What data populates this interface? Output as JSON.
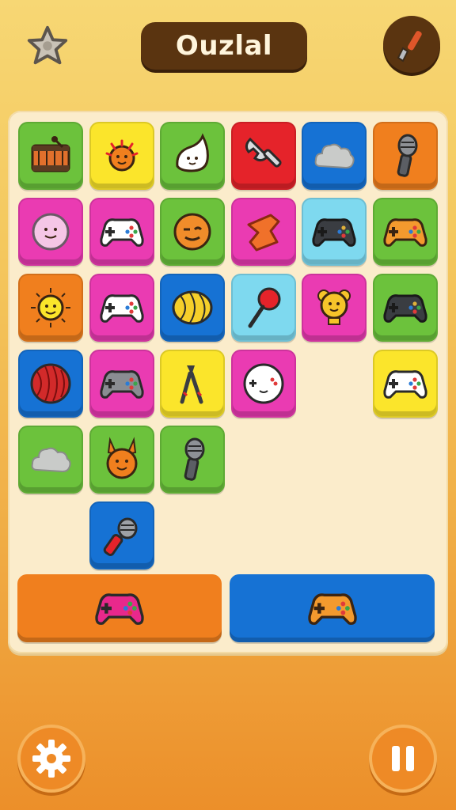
{
  "header": {
    "title": "Ouzlal",
    "star_icon": "star-icon",
    "tool_icon": "wrench-icon"
  },
  "colors": {
    "green": "#6cc23c",
    "yellow": "#fbe52b",
    "red": "#e5232a",
    "blue": "#1672d4",
    "orange": "#f07f1e",
    "pink": "#ea3bb2",
    "cyan": "#7ed9ef",
    "header_brown": "#5a3410"
  },
  "board": {
    "tiles": [
      {
        "row": 0,
        "col": 0,
        "color": "green",
        "icon": "drum-icon"
      },
      {
        "row": 0,
        "col": 1,
        "color": "yellow",
        "icon": "sun-creature-icon"
      },
      {
        "row": 0,
        "col": 2,
        "color": "green",
        "icon": "ghost-blob-icon"
      },
      {
        "row": 0,
        "col": 3,
        "color": "red",
        "icon": "wrench-icon"
      },
      {
        "row": 0,
        "col": 4,
        "color": "blue",
        "icon": "cloud-icon"
      },
      {
        "row": 0,
        "col": 5,
        "color": "orange",
        "icon": "microphone-icon"
      },
      {
        "row": 1,
        "col": 0,
        "color": "pink",
        "icon": "smiley-ball-icon"
      },
      {
        "row": 1,
        "col": 1,
        "color": "pink",
        "icon": "white-gamepad-icon"
      },
      {
        "row": 1,
        "col": 2,
        "color": "green",
        "icon": "winking-face-icon"
      },
      {
        "row": 1,
        "col": 3,
        "color": "pink",
        "icon": "block-icon"
      },
      {
        "row": 1,
        "col": 4,
        "color": "cyan",
        "icon": "black-gamepad-icon"
      },
      {
        "row": 1,
        "col": 5,
        "color": "green",
        "icon": "orange-gamepad-icon"
      },
      {
        "row": 2,
        "col": 0,
        "color": "orange",
        "icon": "sun-icon"
      },
      {
        "row": 2,
        "col": 1,
        "color": "pink",
        "icon": "white-gamepad-icon"
      },
      {
        "row": 2,
        "col": 2,
        "color": "blue",
        "icon": "yellow-ball-icon"
      },
      {
        "row": 2,
        "col": 3,
        "color": "cyan",
        "icon": "maraca-icon"
      },
      {
        "row": 2,
        "col": 4,
        "color": "pink",
        "icon": "bear-trophy-icon"
      },
      {
        "row": 2,
        "col": 5,
        "color": "green",
        "icon": "black-gamepad-icon"
      },
      {
        "row": 3,
        "col": 0,
        "color": "blue",
        "icon": "red-ball-icon"
      },
      {
        "row": 3,
        "col": 1,
        "color": "pink",
        "icon": "grey-gamepad-icon"
      },
      {
        "row": 3,
        "col": 2,
        "color": "yellow",
        "icon": "tongs-icon"
      },
      {
        "row": 3,
        "col": 3,
        "color": "pink",
        "icon": "face-ball-icon"
      },
      {
        "row": 3,
        "col": 5,
        "color": "yellow",
        "icon": "white-gamepad-icon"
      },
      {
        "row": 4,
        "col": 0,
        "color": "green",
        "icon": "cloud-icon"
      },
      {
        "row": 4,
        "col": 1,
        "color": "green",
        "icon": "bunny-icon"
      },
      {
        "row": 4,
        "col": 2,
        "color": "green",
        "icon": "microphone-icon"
      },
      {
        "row": 5,
        "col": 1,
        "color": "blue",
        "icon": "red-microphone-icon"
      }
    ]
  },
  "slots": [
    {
      "color": "orange",
      "icon": "pink-gamepad-icon"
    },
    {
      "color": "blue",
      "icon": "orange-gamepad-icon"
    }
  ],
  "footer": {
    "settings_icon": "gear-icon",
    "pause_icon": "pause-icon"
  }
}
